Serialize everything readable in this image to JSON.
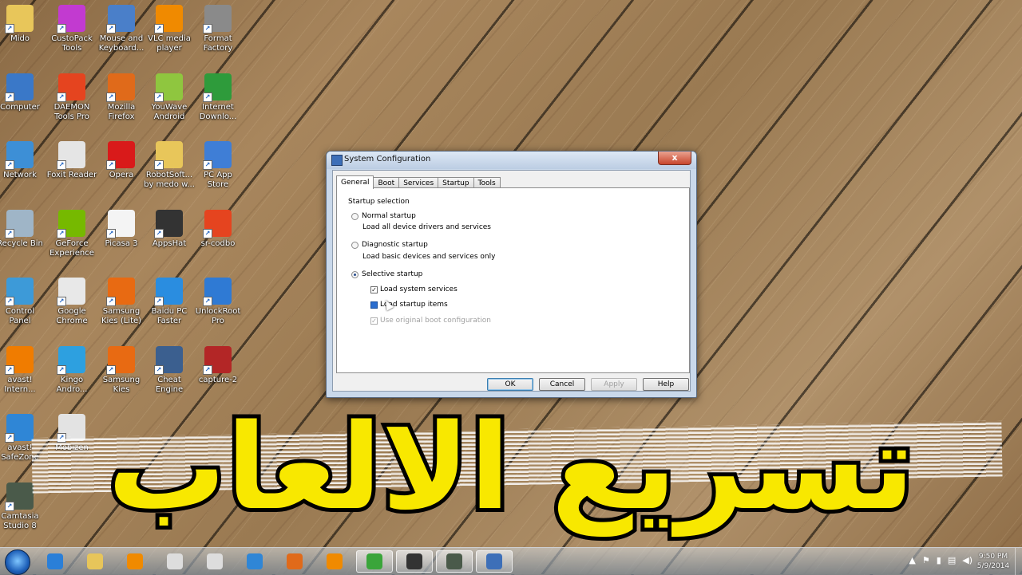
{
  "desktop": {
    "icons": [
      {
        "label": "Mido",
        "icon": "folder-icon"
      },
      {
        "label": "CustoPack Tools",
        "icon": "custopack-icon"
      },
      {
        "label": "Mouse and Keyboard...",
        "icon": "mouse-keyboard-icon"
      },
      {
        "label": "VLC media player",
        "icon": "vlc-icon"
      },
      {
        "label": "Format Factory",
        "icon": "format-factory-icon"
      },
      {
        "label": "Computer",
        "icon": "computer-icon"
      },
      {
        "label": "DAEMON Tools Pro",
        "icon": "daemon-tools-icon"
      },
      {
        "label": "Mozilla Firefox",
        "icon": "firefox-icon"
      },
      {
        "label": "YouWave Android",
        "icon": "android-icon"
      },
      {
        "label": "Internet Downlo...",
        "icon": "internet-download-icon"
      },
      {
        "label": "Network",
        "icon": "network-icon"
      },
      {
        "label": "Foxit Reader",
        "icon": "foxit-icon"
      },
      {
        "label": "Opera",
        "icon": "opera-icon"
      },
      {
        "label": "RobotSoft... by medo w...",
        "icon": "folder-icon"
      },
      {
        "label": "PC App Store",
        "icon": "app-store-icon"
      },
      {
        "label": "Recycle Bin",
        "icon": "recycle-bin-icon"
      },
      {
        "label": "GeForce Experience",
        "icon": "geforce-icon"
      },
      {
        "label": "Picasa 3",
        "icon": "picasa-icon"
      },
      {
        "label": "AppsHat",
        "icon": "appshat-icon"
      },
      {
        "label": "sr-codbo",
        "icon": "daemon-tools-icon"
      },
      {
        "label": "Control Panel",
        "icon": "control-panel-icon"
      },
      {
        "label": "Google Chrome",
        "icon": "chrome-icon"
      },
      {
        "label": "Samsung Kies (Lite)",
        "icon": "kies-icon"
      },
      {
        "label": "Baidu PC Faster",
        "icon": "baidu-icon"
      },
      {
        "label": "UnlockRoot Pro",
        "icon": "unlockroot-icon"
      },
      {
        "label": "avast! Intern...",
        "icon": "avast-icon"
      },
      {
        "label": "Kingo Andro...",
        "icon": "kingo-icon"
      },
      {
        "label": "Samsung Kies",
        "icon": "kies-icon"
      },
      {
        "label": "Cheat Engine",
        "icon": "cheat-engine-icon"
      },
      {
        "label": "capture-2",
        "icon": "video-file-icon"
      },
      {
        "label": "avast! SafeZone",
        "icon": "safezone-icon"
      },
      {
        "label": "Camtasia Studio 8",
        "icon": "camtasia-icon"
      },
      {
        "label": "Mobizen",
        "icon": "mobizen-icon"
      }
    ]
  },
  "dialog": {
    "title": "System Configuration",
    "close_label": "x",
    "tabs": [
      "General",
      "Boot",
      "Services",
      "Startup",
      "Tools"
    ],
    "startup_selection": "Startup selection",
    "normal": {
      "label": "Normal startup",
      "desc": "Load all device drivers and services",
      "selected": false
    },
    "diagnostic": {
      "label": "Diagnostic startup",
      "desc": "Load basic devices and services only",
      "selected": false
    },
    "selective": {
      "label": "Selective startup",
      "selected": true
    },
    "checks": {
      "system_services": {
        "label": "Load system services",
        "checked": true
      },
      "startup_items": {
        "label": "Load startup items",
        "state": "partial"
      },
      "original_boot": {
        "label": "Use original boot configuration",
        "checked": true,
        "disabled": true
      }
    },
    "buttons": {
      "ok": "OK",
      "cancel": "Cancel",
      "apply": "Apply",
      "help": "Help"
    }
  },
  "overlay": {
    "title": "تسريع الالعاب",
    "color": "#f8e800"
  },
  "taskbar": {
    "apps": [
      "ie-icon",
      "explorer-icon",
      "media-player-icon",
      "chrome-icon",
      "chrome-icon",
      "maxthon-icon",
      "firefox-icon",
      "vlc-icon",
      "utorrent-icon",
      "camtasia-recorder-icon",
      "camtasia-icon",
      "system-configuration-icon"
    ],
    "clock_time": "9:50 PM",
    "clock_date": "5/9/2014"
  }
}
